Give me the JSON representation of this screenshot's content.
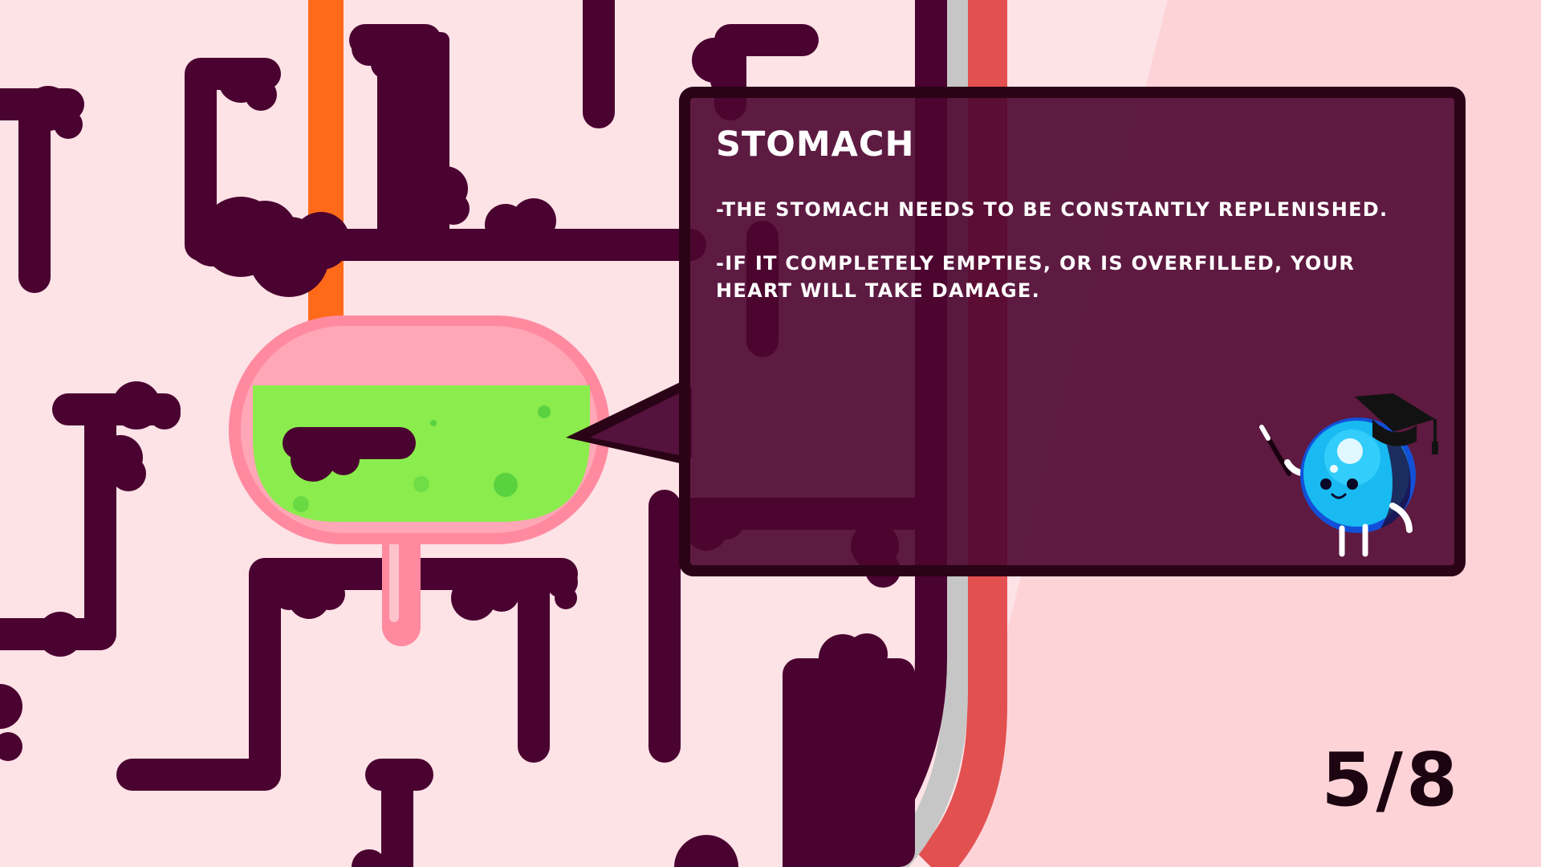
{
  "tutorial": {
    "title": "STOMACH",
    "lines": [
      "-THE STOMACH NEEDS TO BE CONSTANTLY REPLENISHED.",
      "-IF IT COMPLETELY EMPTIES, OR IS OVERFILLED, YOUR HEART WILL TAKE DAMAGE."
    ]
  },
  "pagination": {
    "counter": "5/8",
    "current": 5,
    "total": 8
  },
  "stomach": {
    "fill_level": 0.7
  },
  "icons": {
    "teacher": "teacher-blob-icon",
    "pointer": "pointer-stick-icon"
  },
  "colors": {
    "background": "#fde2e6",
    "tube_dark": "#4a0230",
    "panel": "#4c0630",
    "panel_border": "#2a0316",
    "stomach_wall": "#ff8aa0",
    "stomach_fluid": "#8bec4d",
    "orange_pipe": "#ff6a1a",
    "red_stripe": "#e35050",
    "gray_stripe": "#c6c6c6",
    "teacher_blue": "#19b9f2"
  }
}
